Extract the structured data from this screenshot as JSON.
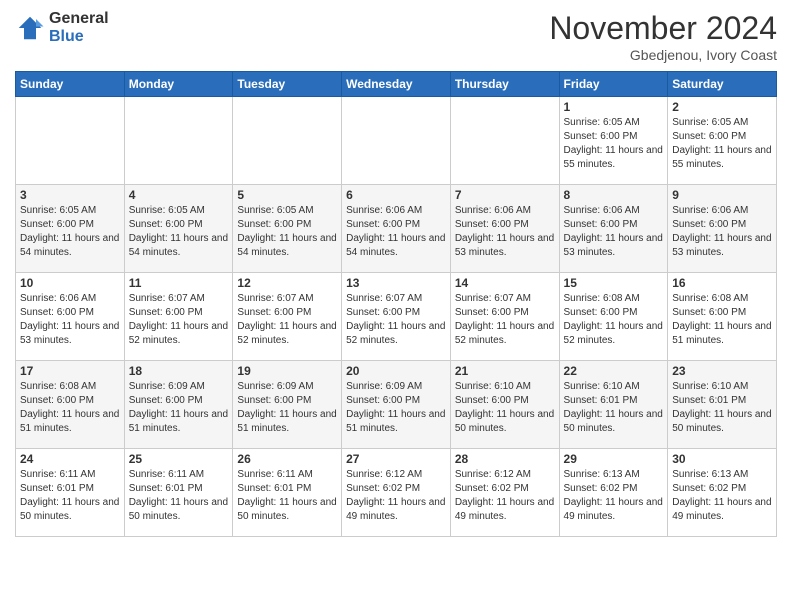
{
  "header": {
    "logo_general": "General",
    "logo_blue": "Blue",
    "month_title": "November 2024",
    "subtitle": "Gbedjenou, Ivory Coast"
  },
  "days_of_week": [
    "Sunday",
    "Monday",
    "Tuesday",
    "Wednesday",
    "Thursday",
    "Friday",
    "Saturday"
  ],
  "weeks": [
    [
      {
        "day": "",
        "info": ""
      },
      {
        "day": "",
        "info": ""
      },
      {
        "day": "",
        "info": ""
      },
      {
        "day": "",
        "info": ""
      },
      {
        "day": "",
        "info": ""
      },
      {
        "day": "1",
        "info": "Sunrise: 6:05 AM\nSunset: 6:00 PM\nDaylight: 11 hours and 55 minutes."
      },
      {
        "day": "2",
        "info": "Sunrise: 6:05 AM\nSunset: 6:00 PM\nDaylight: 11 hours and 55 minutes."
      }
    ],
    [
      {
        "day": "3",
        "info": "Sunrise: 6:05 AM\nSunset: 6:00 PM\nDaylight: 11 hours and 54 minutes."
      },
      {
        "day": "4",
        "info": "Sunrise: 6:05 AM\nSunset: 6:00 PM\nDaylight: 11 hours and 54 minutes."
      },
      {
        "day": "5",
        "info": "Sunrise: 6:05 AM\nSunset: 6:00 PM\nDaylight: 11 hours and 54 minutes."
      },
      {
        "day": "6",
        "info": "Sunrise: 6:06 AM\nSunset: 6:00 PM\nDaylight: 11 hours and 54 minutes."
      },
      {
        "day": "7",
        "info": "Sunrise: 6:06 AM\nSunset: 6:00 PM\nDaylight: 11 hours and 53 minutes."
      },
      {
        "day": "8",
        "info": "Sunrise: 6:06 AM\nSunset: 6:00 PM\nDaylight: 11 hours and 53 minutes."
      },
      {
        "day": "9",
        "info": "Sunrise: 6:06 AM\nSunset: 6:00 PM\nDaylight: 11 hours and 53 minutes."
      }
    ],
    [
      {
        "day": "10",
        "info": "Sunrise: 6:06 AM\nSunset: 6:00 PM\nDaylight: 11 hours and 53 minutes."
      },
      {
        "day": "11",
        "info": "Sunrise: 6:07 AM\nSunset: 6:00 PM\nDaylight: 11 hours and 52 minutes."
      },
      {
        "day": "12",
        "info": "Sunrise: 6:07 AM\nSunset: 6:00 PM\nDaylight: 11 hours and 52 minutes."
      },
      {
        "day": "13",
        "info": "Sunrise: 6:07 AM\nSunset: 6:00 PM\nDaylight: 11 hours and 52 minutes."
      },
      {
        "day": "14",
        "info": "Sunrise: 6:07 AM\nSunset: 6:00 PM\nDaylight: 11 hours and 52 minutes."
      },
      {
        "day": "15",
        "info": "Sunrise: 6:08 AM\nSunset: 6:00 PM\nDaylight: 11 hours and 52 minutes."
      },
      {
        "day": "16",
        "info": "Sunrise: 6:08 AM\nSunset: 6:00 PM\nDaylight: 11 hours and 51 minutes."
      }
    ],
    [
      {
        "day": "17",
        "info": "Sunrise: 6:08 AM\nSunset: 6:00 PM\nDaylight: 11 hours and 51 minutes."
      },
      {
        "day": "18",
        "info": "Sunrise: 6:09 AM\nSunset: 6:00 PM\nDaylight: 11 hours and 51 minutes."
      },
      {
        "day": "19",
        "info": "Sunrise: 6:09 AM\nSunset: 6:00 PM\nDaylight: 11 hours and 51 minutes."
      },
      {
        "day": "20",
        "info": "Sunrise: 6:09 AM\nSunset: 6:00 PM\nDaylight: 11 hours and 51 minutes."
      },
      {
        "day": "21",
        "info": "Sunrise: 6:10 AM\nSunset: 6:00 PM\nDaylight: 11 hours and 50 minutes."
      },
      {
        "day": "22",
        "info": "Sunrise: 6:10 AM\nSunset: 6:01 PM\nDaylight: 11 hours and 50 minutes."
      },
      {
        "day": "23",
        "info": "Sunrise: 6:10 AM\nSunset: 6:01 PM\nDaylight: 11 hours and 50 minutes."
      }
    ],
    [
      {
        "day": "24",
        "info": "Sunrise: 6:11 AM\nSunset: 6:01 PM\nDaylight: 11 hours and 50 minutes."
      },
      {
        "day": "25",
        "info": "Sunrise: 6:11 AM\nSunset: 6:01 PM\nDaylight: 11 hours and 50 minutes."
      },
      {
        "day": "26",
        "info": "Sunrise: 6:11 AM\nSunset: 6:01 PM\nDaylight: 11 hours and 50 minutes."
      },
      {
        "day": "27",
        "info": "Sunrise: 6:12 AM\nSunset: 6:02 PM\nDaylight: 11 hours and 49 minutes."
      },
      {
        "day": "28",
        "info": "Sunrise: 6:12 AM\nSunset: 6:02 PM\nDaylight: 11 hours and 49 minutes."
      },
      {
        "day": "29",
        "info": "Sunrise: 6:13 AM\nSunset: 6:02 PM\nDaylight: 11 hours and 49 minutes."
      },
      {
        "day": "30",
        "info": "Sunrise: 6:13 AM\nSunset: 6:02 PM\nDaylight: 11 hours and 49 minutes."
      }
    ]
  ]
}
